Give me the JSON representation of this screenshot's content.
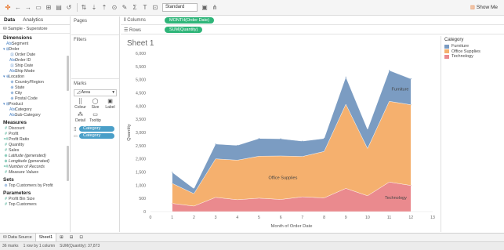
{
  "toolbar": {
    "icons": [
      "tableau-logo-icon",
      "back-icon",
      "forward-icon",
      "save-icon",
      "new-data-source-icon",
      "new-worksheet-icon",
      "undo-icon",
      "swap-icon",
      "sort-asc-icon",
      "sort-desc-icon",
      "group-icon",
      "highlight-icon",
      "totals-icon",
      "labels-icon",
      "fix-axes-icon",
      "fit-select-icon",
      "presentation-icon",
      "share-icon"
    ],
    "fit_value": "Standard",
    "show_me_label": "Show Me"
  },
  "data_pane": {
    "tabs": [
      "Data",
      "Analytics"
    ],
    "data_source": "Sample - Superstore",
    "dimensions_header": "Dimensions",
    "dimensions": [
      {
        "label": "Segment",
        "glyph": "Abc",
        "indent": 1
      },
      {
        "label": "Order",
        "glyph": "▾ ⊞",
        "indent": 0
      },
      {
        "label": "Order Date",
        "glyph": "⊡",
        "indent": 2
      },
      {
        "label": "Order ID",
        "glyph": "Abc",
        "indent": 2
      },
      {
        "label": "Ship Date",
        "glyph": "⊡",
        "indent": 2
      },
      {
        "label": "Ship Mode",
        "glyph": "Abc",
        "indent": 2
      },
      {
        "label": "Location",
        "glyph": "▾ ⊕",
        "indent": 0
      },
      {
        "label": "Country/Region",
        "glyph": "⊕",
        "indent": 2
      },
      {
        "label": "State",
        "glyph": "⊕",
        "indent": 2
      },
      {
        "label": "City",
        "glyph": "⊕",
        "indent": 2
      },
      {
        "label": "Postal Code",
        "glyph": "⊕",
        "indent": 2
      },
      {
        "label": "Product",
        "glyph": "▾ ⊞",
        "indent": 0
      },
      {
        "label": "Category",
        "glyph": "Abc",
        "indent": 2
      },
      {
        "label": "Sub-Category",
        "glyph": "Abc",
        "indent": 2
      }
    ],
    "measures_header": "Measures",
    "measures": [
      {
        "label": "Discount",
        "glyph": "#",
        "italic": false
      },
      {
        "label": "Profit",
        "glyph": "#",
        "italic": false
      },
      {
        "label": "Profit Ratio",
        "glyph": "=#",
        "italic": false
      },
      {
        "label": "Quantity",
        "glyph": "#",
        "italic": false
      },
      {
        "label": "Sales",
        "glyph": "#",
        "italic": false
      },
      {
        "label": "Latitude (generated)",
        "glyph": "⊕",
        "italic": true
      },
      {
        "label": "Longitude (generated)",
        "glyph": "⊕",
        "italic": true
      },
      {
        "label": "Number of Records",
        "glyph": "=#",
        "italic": true
      },
      {
        "label": "Measure Values",
        "glyph": "#",
        "italic": true
      }
    ],
    "sets_header": "Sets",
    "sets": [
      {
        "label": "Top Customers by Profit",
        "glyph": "⊚"
      }
    ],
    "parameters_header": "Parameters",
    "parameters": [
      {
        "label": "Profit Bin Size",
        "glyph": "#"
      },
      {
        "label": "Top Customers",
        "glyph": "#"
      }
    ]
  },
  "cards": {
    "pages_title": "Pages",
    "filters_title": "Filters",
    "marks_title": "Marks",
    "mark_type": "Area",
    "mark_buttons": [
      {
        "label": "Colour",
        "icon": "⣿"
      },
      {
        "label": "Size",
        "icon": "◯"
      },
      {
        "label": "Label",
        "icon": "▣"
      },
      {
        "label": "Detail",
        "icon": "⁂"
      },
      {
        "label": "Tooltip",
        "icon": "▭"
      }
    ],
    "mark_pills": [
      {
        "sym": "⣿",
        "label": "Category"
      },
      {
        "sym": "▭",
        "label": "Category"
      }
    ]
  },
  "shelves": {
    "columns_label": "Columns",
    "columns_pill": "MONTH(Order Date)",
    "rows_label": "Rows",
    "rows_pill": "SUM(Quantity)"
  },
  "sheet": {
    "title": "Sheet 1"
  },
  "legend": {
    "title": "Category",
    "items": [
      {
        "label": "Furniture",
        "color": "#7b9cc2"
      },
      {
        "label": "Office Supplies",
        "color": "#f5b06e"
      },
      {
        "label": "Technology",
        "color": "#ea8a8e"
      }
    ]
  },
  "chart_data": {
    "type": "area",
    "stacked": true,
    "x": [
      1,
      2,
      3,
      4,
      5,
      6,
      7,
      8,
      9,
      10,
      11,
      12
    ],
    "xlim": [
      0,
      13
    ],
    "x_ticks": [
      0,
      1,
      2,
      3,
      4,
      5,
      6,
      7,
      8,
      9,
      10,
      11,
      12,
      13
    ],
    "xlabel": "Month of Order Date",
    "ylabel": "Quantity",
    "ylim": [
      0,
      6000
    ],
    "y_ticks": [
      0,
      500,
      1000,
      1500,
      2000,
      2500,
      3000,
      3500,
      4000,
      4500,
      5000,
      5500,
      6000
    ],
    "y_tick_labels": [
      "0",
      "500",
      "1,000",
      "1,500",
      "2,000",
      "2,500",
      "3,000",
      "3,500",
      "4,000",
      "4,500",
      "5,000",
      "5,500",
      "6,000"
    ],
    "series": [
      {
        "name": "Technology",
        "color": "#ea8a8e",
        "values": [
          310,
          210,
          540,
          450,
          510,
          460,
          560,
          520,
          880,
          600,
          1120,
          990
        ]
      },
      {
        "name": "Office Supplies",
        "color": "#f5b06e",
        "values": [
          760,
          470,
          1460,
          1500,
          1590,
          1650,
          1530,
          1760,
          3190,
          1790,
          3060,
          3060
        ]
      },
      {
        "name": "Furniture",
        "color": "#7b9cc2",
        "values": [
          420,
          190,
          560,
          560,
          670,
          650,
          580,
          490,
          1030,
          720,
          1170,
          980
        ]
      }
    ],
    "annotations": [
      {
        "text": "Furniture",
        "series": "Furniture"
      },
      {
        "text": "Office Supplies",
        "series": "Office Supplies"
      },
      {
        "text": "Technology",
        "series": "Technology"
      }
    ],
    "grid": false
  },
  "sheet_tabs": {
    "data_source_tab": "Data Source",
    "sheets": [
      "Sheet1"
    ],
    "tab_icons": [
      "new-worksheet-tab-icon",
      "new-dashboard-tab-icon",
      "new-story-tab-icon"
    ]
  },
  "status_bar": {
    "marks": "36 marks",
    "rows_cols": "1 row by 1 column",
    "sum": "SUM(Quantity): 37,873"
  }
}
